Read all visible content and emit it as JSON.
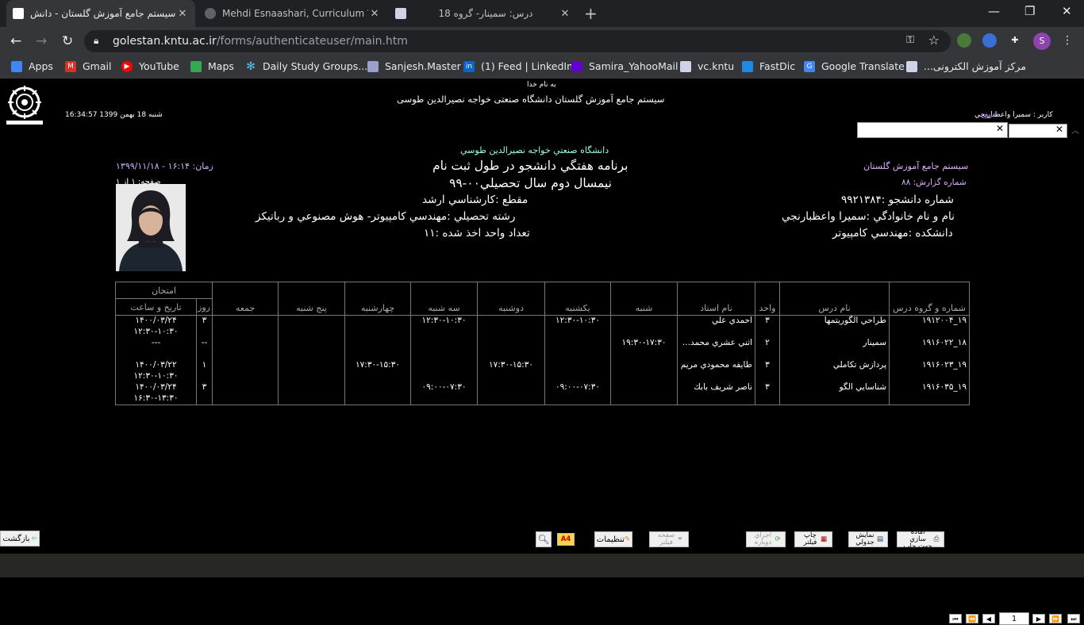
{
  "browser": {
    "tabs": [
      {
        "title": "سیستم جامع آموزش گلستان - دانش",
        "active": true
      },
      {
        "title": "Mehdi Esnaashari, Curriculum Vit",
        "active": false
      },
      {
        "title": "درس: سمینار- گروه 18",
        "active": false
      }
    ],
    "url_host": "golestan.kntu.ac.ir",
    "url_path": "/forms/authenticateuser/main.htm",
    "profile_initial": "S",
    "bookmarks": [
      "Apps",
      "Gmail",
      "YouTube",
      "Maps",
      "Daily Study Groups...",
      "Sanjesh.Master",
      "(1) Feed | LinkedIn",
      "Samira_YahooMail",
      "vc.kntu",
      "FastDic",
      "Google Translate",
      "مرکز آموزش الکترونی..."
    ]
  },
  "header": {
    "bismillah": "به نام خدا",
    "system_title": "سیستم جامع آموزش گلستان   دانشگاه صنعتی خواجه نصیرالدین طوسی",
    "datetime": "16:34:57 شنبه 18 بهمن 1399",
    "user": "کاربر : سميرا واعظبارنجي",
    "logout": "خروج"
  },
  "report": {
    "university": "دانشگاه صنعتي خواجه نصيرالدين طوسي",
    "time": "زمان: ۱۶:۱۴ - ۱۳۹۹/۱۱/۱۸",
    "pages": "صفحه: ۱ از ۱",
    "title": "برنامه هفتگي دانشجو در طول ثبت نام",
    "semester": "نيمسال دوم سال تحصيلي۰۰-۹۹",
    "system": "سيستم جامع آموزش گلستان",
    "report_number": "شماره گزارش: ۸۸",
    "student_no": "شماره دانشجو :۹۹۲۱۳۸۴",
    "student_name": "نام و نام خانوادگي :سميرا واعظبارنجي",
    "faculty": "دانشكده :مهندسي كامپيوتر",
    "degree": "مقطع :كارشناسي ارشد",
    "major": "رشته تحصيلي :مهندسي كامپيوتر- هوش مصنوعي و رباتيكز",
    "units": "تعداد واحد اخذ شده :۱۱"
  },
  "table": {
    "headers": {
      "course_code": "شماره و گروه درس",
      "course_name": "نام درس",
      "units": "واحد",
      "instructor": "نام استاد",
      "sat": "شنبه",
      "sun": "يكشنبه",
      "mon": "دوشنبه",
      "tue": "سه شنبه",
      "wed": "چهارشنبه",
      "thu": "پنج شنبه",
      "fri": "جمعه",
      "exam": "امتحان",
      "exam_day": "روز",
      "exam_datetime": "تاريخ و ساعت"
    },
    "rows": [
      {
        "code": "۱۹_۱۹۱۲۰۰۴",
        "name": "طراحي الگوريتمها",
        "units": "۳",
        "instructor": "احمدي علي",
        "sat": "",
        "sun": "۱۲:۳۰-۱۰:۳۰",
        "mon": "",
        "tue": "۱۲:۳۰-۱۰:۳۰",
        "wed": "",
        "thu": "",
        "fri": "",
        "exam_day": "۳",
        "exam_date": "۱۴۰۰/۰۳/۲۴",
        "exam_time": "۱۲:۳۰-۱۰:۳۰"
      },
      {
        "code": "۱۸_۱۹۱۶۰۲۲",
        "name": "سمينار",
        "units": "۲",
        "instructor": "اثني عشري محمد...",
        "sat": "۱۹:۳۰-۱۷:۳۰",
        "sun": "",
        "mon": "",
        "tue": "",
        "wed": "",
        "thu": "",
        "fri": "",
        "exam_day": "--",
        "exam_date": "---",
        "exam_time": ""
      },
      {
        "code": "۱۹_۱۹۱۶۰۲۳",
        "name": "پردازش تكاملي",
        "units": "۳",
        "instructor": "طايفه محمودي مريم",
        "sat": "",
        "sun": "",
        "mon": "۱۷:۳۰-۱۵:۳۰",
        "tue": "",
        "wed": "۱۷:۳۰-۱۵:۳۰",
        "thu": "",
        "fri": "",
        "exam_day": "۱",
        "exam_date": "۱۴۰۰/۰۳/۲۲",
        "exam_time": "۱۲:۳۰-۱۰:۳۰"
      },
      {
        "code": "۱۹_۱۹۱۶۰۳۵",
        "name": "شناسايي الگو",
        "units": "۳",
        "instructor": "ناصر شريف بابك",
        "sat": "",
        "sun": "۰۹:۰۰-۰۷:۳۰",
        "mon": "",
        "tue": "۰۹:۰۰-۰۷:۳۰",
        "wed": "",
        "thu": "",
        "fri": "",
        "exam_day": "۳",
        "exam_date": "۱۴۰۰/۰۳/۲۴",
        "exam_time": "۱۶:۳۰-۱۳:۳۰"
      }
    ]
  },
  "bottom_bar": {
    "back": "بازگشت",
    "paper": "A4",
    "settings": "تنظيمات",
    "filter_page": "صفحه فيلتر",
    "rerun": "اجراي دوباره",
    "print_filter": "چاپ فيلتر",
    "table_view": "نمايش جدولي",
    "ready_print": "آماده سازي جهت چاپ",
    "page_number": "1"
  }
}
